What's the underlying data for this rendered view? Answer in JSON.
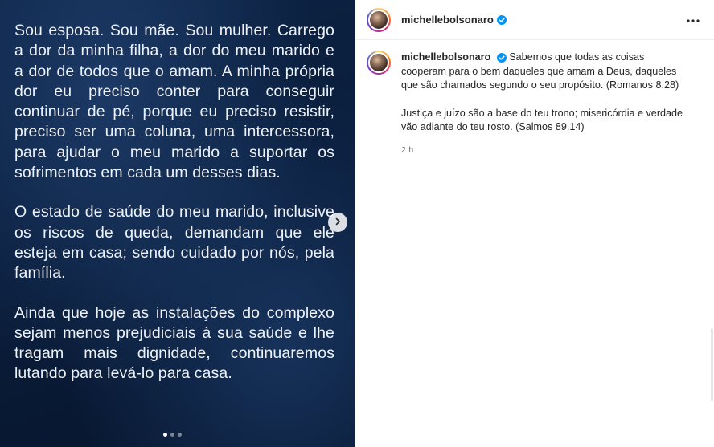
{
  "post_image": {
    "paragraphs": [
      "Sou esposa. Sou mãe. Sou mulher. Carrego a dor da minha filha, a dor do meu marido e a dor de todos que o amam. A minha própria dor eu preciso conter para conseguir continuar de pé, porque eu preciso resistir, preciso ser uma coluna, uma intercessora, para ajudar o meu marido a suportar os sofrimentos em cada um desses dias.",
      "O estado de saúde do meu marido, inclusive os riscos de queda, demandam que ele esteja em casa; sendo cuidado por nós, pela família.",
      "Ainda que hoje as instalações do complexo sejam menos prejudiciais à sua saúde e lhe tragam mais dignidade, continuaremos lutando para levá-lo para casa."
    ],
    "carousel_total": 3,
    "carousel_active": 1
  },
  "header": {
    "username": "michellebolsonaro"
  },
  "caption": {
    "username": "michellebolsonaro",
    "line1": "Sabemos que todas as coisas cooperam para o bem daqueles que amam a Deus, daqueles que são chamados segundo o seu propósito. (Romanos 8.28)",
    "line2": "Justiça e juízo são a base do teu trono; misericórdia e verdade vão adiante do teu rosto. (Salmos 89.14)",
    "timestamp": "2 h"
  },
  "colors": {
    "verified": "#0095f6",
    "text": "#262626",
    "muted": "#737373"
  },
  "icons": {
    "verified": "verified-badge-icon",
    "more": "more-options-icon",
    "next": "chevron-right-icon"
  }
}
